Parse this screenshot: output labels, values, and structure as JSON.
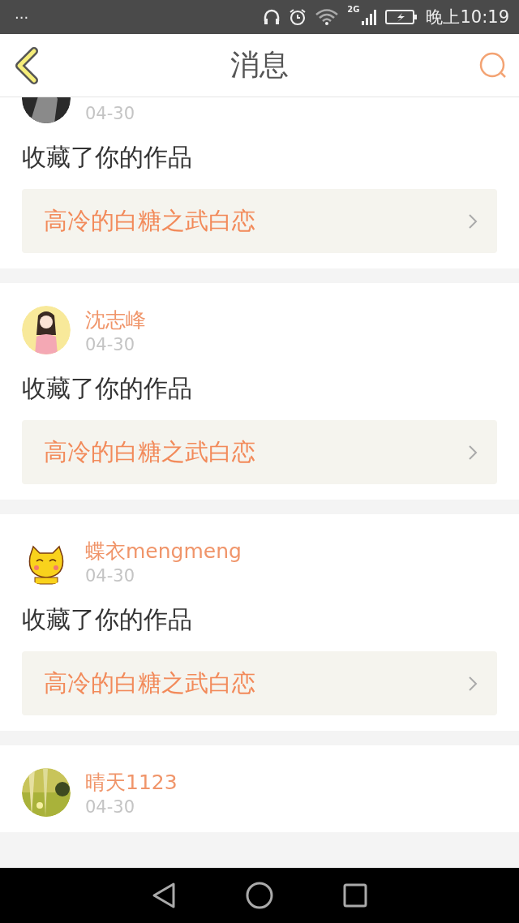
{
  "status_bar": {
    "left": "···",
    "time": "晚上10:19",
    "network": "2G"
  },
  "header": {
    "title": "消息"
  },
  "messages": [
    {
      "date": "04-30",
      "action": "收藏了你的作品",
      "work": "高冷的白糖之武白恋"
    },
    {
      "name": "沈志峰",
      "date": "04-30",
      "action": "收藏了你的作品",
      "work": "高冷的白糖之武白恋"
    },
    {
      "name": "蝶衣mengmeng",
      "date": "04-30",
      "action": "收藏了你的作品",
      "work": "高冷的白糖之武白恋"
    },
    {
      "name": "晴天1123",
      "date": "04-30"
    }
  ]
}
